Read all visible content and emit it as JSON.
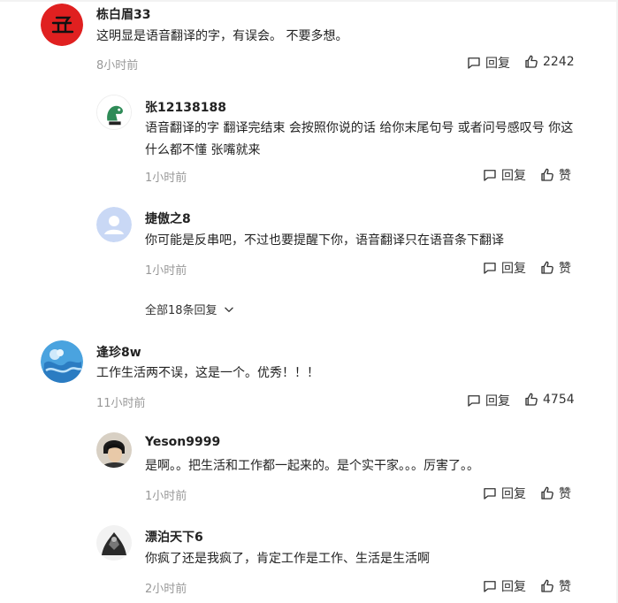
{
  "comments": [
    {
      "user": "栋白眉33",
      "text": "这明显是语音翻译的字，有误会。 不要多想。",
      "time": "8小时前",
      "reply_label": "回复",
      "likes": "2242",
      "replies": [
        {
          "user": "张12138188",
          "text": "语音翻译的字 翻译完结束 会按照你说的话 给你末尾句号 或者问号感叹号 你这什么都不懂 张嘴就来",
          "time": "1小时前",
          "reply_label": "回复",
          "like_label": "赞"
        },
        {
          "user": "捷傲之8",
          "text": "你可能是反串吧，不过也要提醒下你，语音翻译只在语音条下翻译",
          "time": "1小时前",
          "reply_label": "回复",
          "like_label": "赞"
        }
      ],
      "expand_label": "全部18条回复"
    },
    {
      "user": "逢珍8w",
      "text": "工作生活两不误，这是一个。优秀！！！",
      "time": "11小时前",
      "reply_label": "回复",
      "likes": "4754",
      "replies": [
        {
          "user": "Yeson9999",
          "text": "是啊。。把生活和工作都一起来的。是个实干家。。。厉害了。。",
          "time": "1小时前",
          "reply_label": "回复",
          "like_label": "赞"
        },
        {
          "user": "漂泊天下6",
          "text": "你疯了还是我疯了，肯定工作是工作、生活是生活啊",
          "time": "2小时前",
          "reply_label": "回复",
          "like_label": "赞"
        }
      ]
    }
  ],
  "colors": {
    "meta": "#999999",
    "text": "#222222",
    "avatar1": "#e02020",
    "avatar3": "#4aa3df"
  }
}
